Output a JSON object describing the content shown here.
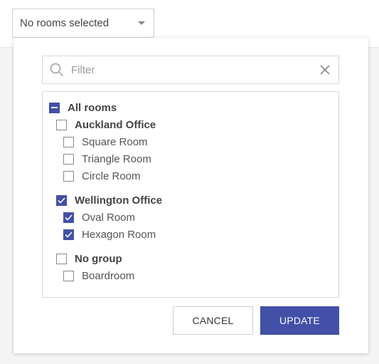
{
  "dropdown": {
    "label": "No rooms selected",
    "caret_icon": "caret-down-icon"
  },
  "filter": {
    "placeholder": "Filter",
    "value": "",
    "search_icon": "search-icon",
    "clear_icon": "close-icon"
  },
  "tree": {
    "all": {
      "label": "All rooms",
      "state": "partial"
    },
    "groups": [
      {
        "label": "Auckland Office",
        "checked": false,
        "rooms": [
          {
            "label": "Square Room",
            "checked": false
          },
          {
            "label": "Triangle Room",
            "checked": false
          },
          {
            "label": "Circle Room",
            "checked": false
          }
        ]
      },
      {
        "label": "Wellington Office",
        "checked": true,
        "rooms": [
          {
            "label": "Oval Room",
            "checked": true
          },
          {
            "label": "Hexagon Room",
            "checked": true
          }
        ]
      },
      {
        "label": "No group",
        "checked": false,
        "rooms": [
          {
            "label": "Boardroom",
            "checked": false
          }
        ]
      }
    ]
  },
  "actions": {
    "cancel_label": "CANCEL",
    "update_label": "UPDATE"
  },
  "colors": {
    "accent": "#4250a8",
    "border": "#d8d8d8"
  }
}
